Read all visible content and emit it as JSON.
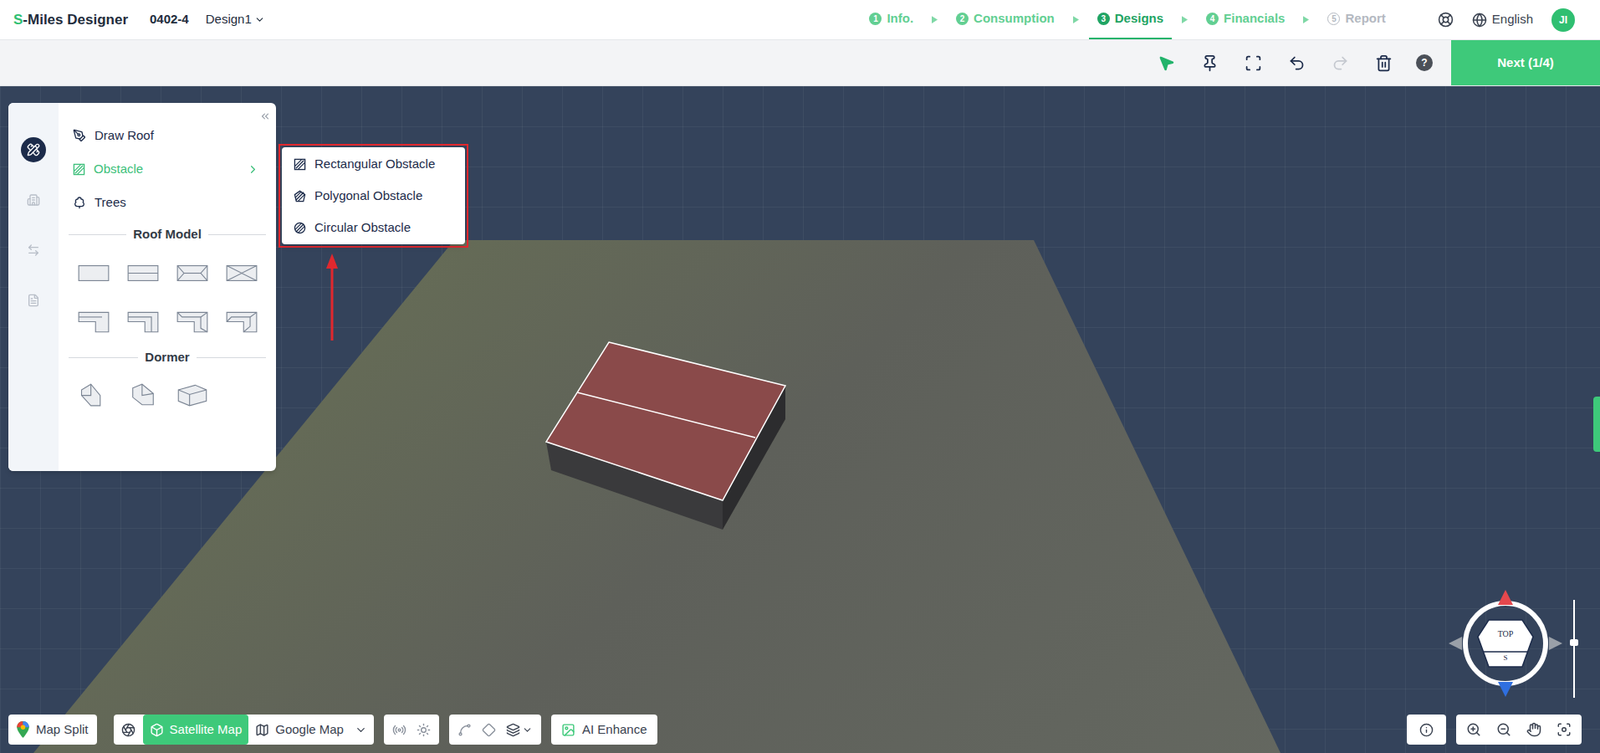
{
  "app": {
    "logo_mark": "S",
    "logo_text": "-Miles Designer",
    "project": "0402-4",
    "design": "Design1"
  },
  "steps": [
    {
      "number": "1",
      "label": "Info.",
      "selected": false,
      "done": true
    },
    {
      "number": "2",
      "label": "Consumption",
      "selected": false,
      "done": true
    },
    {
      "number": "3",
      "label": "Designs",
      "selected": true,
      "done": true
    },
    {
      "number": "4",
      "label": "Financials",
      "selected": false,
      "done": true
    },
    {
      "number": "5",
      "label": "Report",
      "selected": false,
      "done": false
    }
  ],
  "header": {
    "language": "English",
    "avatar": "JI"
  },
  "toolbar": {
    "tools": [
      {
        "kind": "select",
        "selected": true,
        "disabled": false
      },
      {
        "kind": "pin",
        "selected": false,
        "disabled": false
      },
      {
        "kind": "frame",
        "selected": false,
        "disabled": false
      },
      {
        "kind": "undo",
        "selected": false,
        "disabled": false
      },
      {
        "kind": "redo",
        "selected": false,
        "disabled": true
      },
      {
        "kind": "delete",
        "selected": false,
        "disabled": false
      }
    ],
    "help": "?",
    "next": "Next (1/4)"
  },
  "sidebar": {
    "tabs": [
      {
        "kind": "tools",
        "selected": true
      },
      {
        "kind": "building",
        "selected": false
      },
      {
        "kind": "swap",
        "selected": false
      },
      {
        "kind": "report",
        "selected": false
      }
    ],
    "items": [
      {
        "kind": "draw",
        "label": "Draw Roof",
        "selected": false,
        "submenu": false
      },
      {
        "kind": "obstacle",
        "label": "Obstacle",
        "selected": true,
        "submenu": true
      },
      {
        "kind": "tree",
        "label": "Trees",
        "selected": false,
        "submenu": false
      }
    ],
    "roof_model": {
      "title": "Roof Model",
      "models": [
        "flat",
        "gable",
        "hip",
        "hip-cross",
        "shed-l",
        "l-gable",
        "l-hip",
        "l-cross"
      ]
    },
    "dormer": {
      "title": "Dormer",
      "models": [
        "d1",
        "d2",
        "d3"
      ]
    }
  },
  "submenu": {
    "highlighted": true,
    "items": [
      {
        "kind": "rect",
        "label": "Rectangular Obstacle"
      },
      {
        "kind": "polygon",
        "label": "Polygonal Obstacle"
      },
      {
        "kind": "circle",
        "label": "Circular Obstacle"
      }
    ]
  },
  "map_bar": {
    "map_split": "Map Split",
    "sources": [
      {
        "kind": "satellite",
        "label": "Satellite Map",
        "selected": true
      },
      {
        "kind": "google",
        "label": "Google Map",
        "selected": false
      }
    ],
    "ai_enhance": "AI Enhance"
  },
  "compass": {
    "top": "TOP",
    "bottom": "S"
  },
  "zoom_slider": {
    "level": 0.56
  }
}
